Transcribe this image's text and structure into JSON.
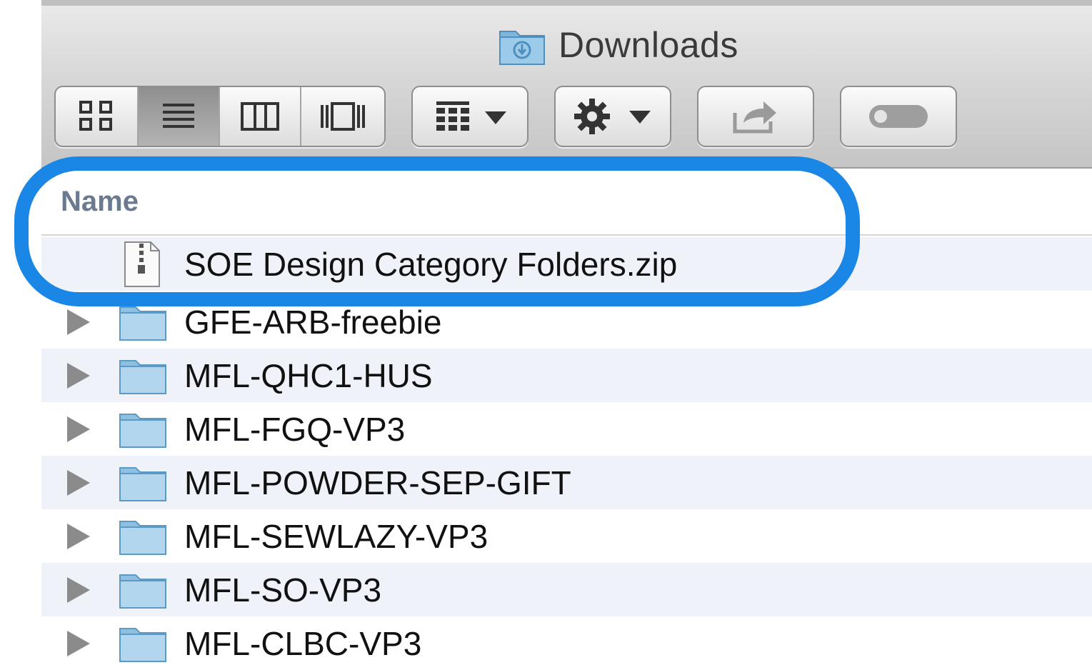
{
  "window": {
    "title": "Downloads",
    "title_icon": "downloads-folder-icon"
  },
  "toolbar": {
    "view_buttons": [
      {
        "name": "icon-view",
        "icon": "grid-icon",
        "active": false
      },
      {
        "name": "list-view",
        "icon": "list-icon",
        "active": true
      },
      {
        "name": "column-view",
        "icon": "columns-icon",
        "active": false
      },
      {
        "name": "cover-flow-view",
        "icon": "cover-flow-icon",
        "active": false
      }
    ],
    "arrange_icon": "arrange-icon",
    "action_icon": "gear-icon",
    "share_icon": "share-icon",
    "tags_icon": "tags-toggle-icon"
  },
  "list": {
    "column_header": "Name",
    "highlighted_item": {
      "name": "SOE Design Category Folders.zip",
      "icon": "zip-file-icon"
    },
    "items": [
      {
        "name": "GFE-ARB-freebie",
        "icon": "folder-icon"
      },
      {
        "name": "MFL-QHC1-HUS",
        "icon": "folder-icon"
      },
      {
        "name": "MFL-FGQ-VP3",
        "icon": "folder-icon"
      },
      {
        "name": "MFL-POWDER-SEP-GIFT",
        "icon": "folder-icon"
      },
      {
        "name": "MFL-SEWLAZY-VP3",
        "icon": "folder-icon"
      },
      {
        "name": "MFL-SO-VP3",
        "icon": "folder-icon"
      },
      {
        "name": "MFL-CLBC-VP3",
        "icon": "folder-icon"
      }
    ]
  },
  "colors": {
    "callout": "#1a86e6",
    "row_alt": "#eff3f9",
    "header_text": "#6b7a8f"
  }
}
